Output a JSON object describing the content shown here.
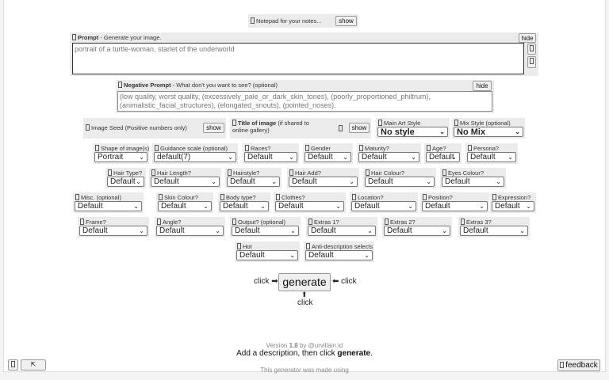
{
  "notepad": {
    "label": "Notepad for your notes...",
    "show": "show"
  },
  "prompt": {
    "title": "Prompt",
    "subtitle": "- Generate your image.",
    "value": "portrait of a turtle-woman, starlet of the underworld",
    "hide": "hide"
  },
  "negative": {
    "title": "Negative Prompt",
    "subtitle": "- What don't you want to see? (optional)",
    "value": "(low quality, worst quality, (excessively_pale_or_dark_skin_tones), (poorly_proportioned_philtrum), (animalistic_facial_structures), (elongated_snouts), (pointed_noses).",
    "hide": "hide"
  },
  "seed": {
    "label": "Image Seed (Positive numbers only)",
    "show": "show"
  },
  "image_title": {
    "title": "Title of image",
    "subtitle": "(if shared to online gallery)",
    "show": "show"
  },
  "fields": [
    {
      "label": "Main Art Style",
      "value": "No style"
    },
    {
      "label": "Mix Style (optional)",
      "value": "No Mix"
    },
    {
      "label": "Shape of image(s)",
      "value": "Portrait"
    },
    {
      "label": "Guidance scale (optional)",
      "value": "default(7)"
    },
    {
      "label": "Races?",
      "value": "Default"
    },
    {
      "label": "Gender",
      "value": "Default"
    },
    {
      "label": "Maturity?",
      "value": "Default"
    },
    {
      "label": "Age?",
      "value": "Default"
    },
    {
      "label": "Persona?",
      "value": "Default"
    },
    {
      "label": "Hair Type?",
      "value": "Default"
    },
    {
      "label": "Hair Length?",
      "value": "Default"
    },
    {
      "label": "Hairstyle?",
      "value": "Default"
    },
    {
      "label": "Hair Add?",
      "value": "Default"
    },
    {
      "label": "Hair Colour?",
      "value": "Default"
    },
    {
      "label": "Eyes Colour?",
      "value": "Default"
    },
    {
      "label": "Misc. (optional)",
      "value": "Default"
    },
    {
      "label": "Skin Colour?",
      "value": "Default"
    },
    {
      "label": "Body type?",
      "value": "Default"
    },
    {
      "label": "Clothes?",
      "value": "Default"
    },
    {
      "label": "Location?",
      "value": "Default"
    },
    {
      "label": "Position?",
      "value": "Default"
    },
    {
      "label": "Expression?",
      "value": "Default"
    },
    {
      "label": "Frame?",
      "value": "Default"
    },
    {
      "label": "Angle?",
      "value": "Default"
    },
    {
      "label": "Output? (optional)",
      "value": "Default"
    },
    {
      "label": "Extras 1?",
      "value": "Default"
    },
    {
      "label": "Extras 2?",
      "value": "Default"
    },
    {
      "label": "Extras 3?",
      "value": "Default"
    },
    {
      "label": "Hot",
      "value": "Default"
    },
    {
      "label": "Anti-description selects",
      "value": "Default"
    }
  ],
  "generate": {
    "label": "generate",
    "click": "click"
  },
  "footer": {
    "version_prefix": "Version",
    "version": "1.8",
    "by": "by @urvillain.id",
    "instruction": "Add a description, then click",
    "instruction_bold": "generate",
    "made_using": "This generator was made using",
    "feedback": "feedback",
    "up_arrow": "⇱"
  }
}
